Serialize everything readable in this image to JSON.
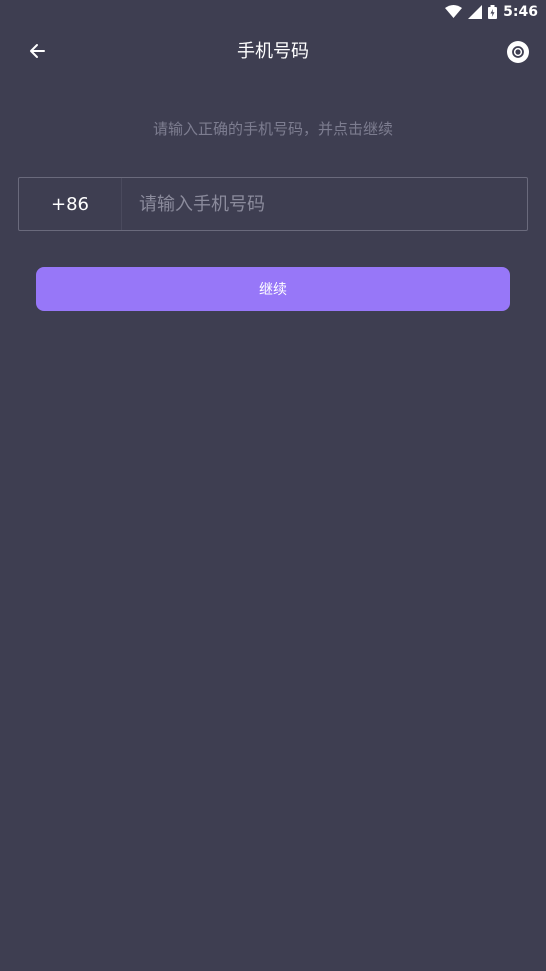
{
  "status_bar": {
    "time": "5:46",
    "icons": [
      "wifi-icon",
      "signal-icon",
      "battery-icon"
    ]
  },
  "toolbar": {
    "back_icon": "arrow-left-icon",
    "title": "手机号码",
    "right_icon": "record-icon"
  },
  "main": {
    "hint": "请输入正确的手机号码，并点击继续",
    "country_code": "+86",
    "phone_placeholder": "请输入手机号码",
    "phone_value": "",
    "continue_label": "继续"
  },
  "colors": {
    "background": "#3e3e51",
    "accent": "#9777f8",
    "hint_text": "#7d7d90",
    "input_border": "#6a6a7c"
  }
}
